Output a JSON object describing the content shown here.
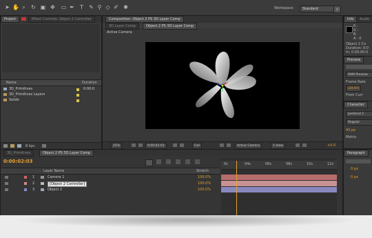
{
  "workspace": {
    "label": "Workspace:",
    "value": "Standard"
  },
  "project": {
    "tabs": [
      "Project",
      "Effect Controls: Object 2 Controller"
    ],
    "columns": {
      "name": "Name",
      "duration": "Duration"
    },
    "items": [
      {
        "name": "3D_Primitives",
        "duration": "0:00:0"
      },
      {
        "name": "3D_Primitives Layers",
        "duration": ""
      },
      {
        "name": "Solids",
        "duration": ""
      }
    ],
    "bpc": "8 bpc"
  },
  "composition": {
    "tab": "Composition: Object 2 PS 3D Layer Comp",
    "sub_tab_dim": "3D Layer Comp",
    "sub_tab": "Object 2 PS 3D Layer Comp",
    "view_label": "Active Camera",
    "footer": {
      "zoom": "25%",
      "timecode": "0:00:02:03",
      "resolution": "Full",
      "camera": "Active Camera",
      "views": "1 View",
      "offset": "+0.0"
    }
  },
  "info": {
    "tabs": [
      "Info",
      "Audio"
    ],
    "channels": [
      "R :",
      "G :",
      "B :",
      "A : 0"
    ],
    "lines": [
      "Object 2 Co",
      "Duration: 0:0",
      "In: 0:00:00:0"
    ]
  },
  "preview": {
    "tab": "Preview",
    "ram": "RAM Preview",
    "frame_rate_label": "Frame Rate",
    "frame_rate": "(29.97)",
    "from_current": "From Curr"
  },
  "character": {
    "tab": "Character",
    "font": "JoeHand 2",
    "style": "Regular",
    "size": "43 px",
    "metric": "Metric"
  },
  "paragraph": {
    "tab": "Paragraph",
    "values": [
      "0 px",
      "0 px"
    ]
  },
  "timeline": {
    "tabs": [
      "3D_Primitives",
      "Object 2 PS 3D Layer Comp"
    ],
    "timecode": "0:00:02:03",
    "columns": {
      "name": "Layer Name",
      "stretch": "Stretch"
    },
    "layers": [
      {
        "num": "1",
        "name": "Camera 1",
        "color": "#d06464",
        "stretch": "100.0%"
      },
      {
        "num": "2",
        "name": "[Object 2 Controller]",
        "color": "#d08a8a",
        "stretch": "100.0%"
      },
      {
        "num": "3",
        "name": "Object 2",
        "color": "#8a8ad0",
        "stretch": "100.0%"
      }
    ],
    "ruler": [
      "0s",
      "04s",
      "06s",
      "08s",
      "10s",
      "12s"
    ],
    "playhead_frac": 0.13
  },
  "colors": {
    "accent": "#e8a030",
    "timecode": "#e8a030",
    "label_yellow": "#d8c84a"
  }
}
